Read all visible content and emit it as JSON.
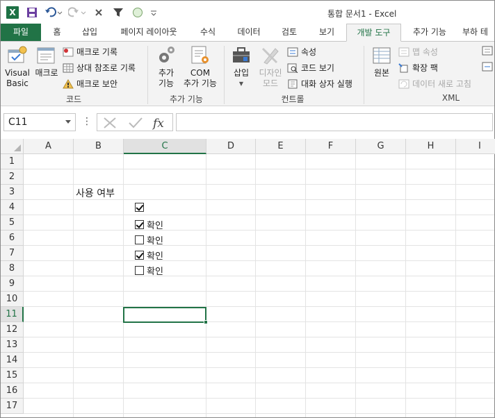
{
  "window": {
    "title": "통합 문서1 - Excel"
  },
  "qat": {
    "excel_letter": "X"
  },
  "tabs": [
    {
      "label": "파일"
    },
    {
      "label": "홈"
    },
    {
      "label": "삽입"
    },
    {
      "label": "페이지 레이아웃"
    },
    {
      "label": "수식"
    },
    {
      "label": "데이터"
    },
    {
      "label": "검토"
    },
    {
      "label": "보기"
    },
    {
      "label": "개발 도구"
    },
    {
      "label": "추가 기능"
    },
    {
      "label": "부하 테"
    }
  ],
  "ribbon": {
    "code": {
      "label": "코드",
      "visual_basic": "Visual\nBasic",
      "vb_line1": "Visual",
      "vb_line2": "Basic",
      "macro": "매크로",
      "record_macro": "매크로 기록",
      "relative_ref": "상대 참조로 기록",
      "macro_security": "매크로 보안"
    },
    "addins": {
      "label": "추가 기능",
      "addins_l1": "추가",
      "addins_l2": "기능",
      "com_l1": "COM",
      "com_l2": "추가 기능"
    },
    "controls": {
      "label": "컨트롤",
      "insert": "삽입",
      "design_l1": "디자인",
      "design_l2": "모드",
      "properties": "속성",
      "view_code": "코드 보기",
      "run_dialog": "대화 상자 실행"
    },
    "xml": {
      "label": "XML",
      "source": "원본",
      "map_props": "맵 속성",
      "expansion_packs": "확장 팩",
      "refresh_data": "데이터 새로 고침"
    }
  },
  "formula_bar": {
    "name_box": "C11",
    "dots": "⋮",
    "formula": ""
  },
  "columns": [
    "A",
    "B",
    "C",
    "D",
    "E",
    "F",
    "G",
    "H",
    "I"
  ],
  "rows": [
    "1",
    "2",
    "3",
    "4",
    "5",
    "6",
    "7",
    "8",
    "9",
    "10",
    "11",
    "12",
    "13",
    "14",
    "15",
    "16",
    "17"
  ],
  "sheet": {
    "b3": "사용 여부",
    "checkboxes": [
      {
        "row": "4",
        "checked": true,
        "label": ""
      },
      {
        "row": "5",
        "checked": true,
        "label": "확인"
      },
      {
        "row": "6",
        "checked": false,
        "label": "확인"
      },
      {
        "row": "7",
        "checked": true,
        "label": "확인"
      },
      {
        "row": "8",
        "checked": false,
        "label": "확인"
      }
    ]
  },
  "selected_cell": "C11",
  "colors": {
    "accent": "#217346",
    "file_tab": "#217346"
  }
}
